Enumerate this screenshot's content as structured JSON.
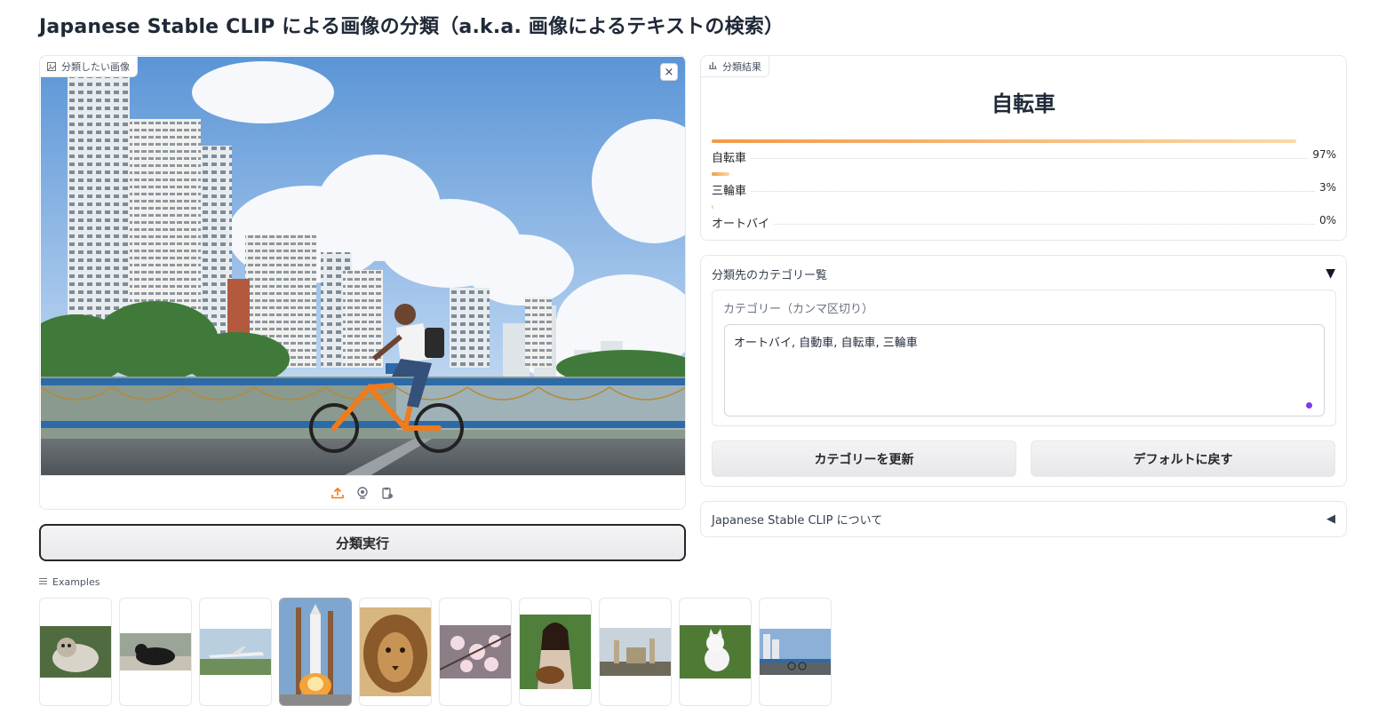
{
  "page": {
    "title": "Japanese Stable CLIP による画像の分類（a.k.a. 画像によるテキストの検索）"
  },
  "image_input": {
    "label": "分類したい画像",
    "close_symbol": "×"
  },
  "run_button": "分類実行",
  "result": {
    "label": "分類結果",
    "top_label": "自転車",
    "confidences": [
      {
        "label": "自転車",
        "percent_text": "97%",
        "value": 0.97
      },
      {
        "label": "三輪車",
        "percent_text": "3%",
        "value": 0.03
      },
      {
        "label": "オートバイ",
        "percent_text": "0%",
        "value": 0.0
      }
    ]
  },
  "categories": {
    "accordion_title": "分類先のカテゴリー覧",
    "accordion_arrow": "▼",
    "textbox_label": "カテゴリー（カンマ区切り）",
    "textbox_value": "オートバイ, 自動車, 自転車, 三輪車",
    "update_button": "カテゴリーを更新",
    "reset_button": "デフォルトに戻す"
  },
  "about": {
    "title": "Japanese Stable CLIP について",
    "arrow": "◀"
  },
  "examples": {
    "label": "Examples",
    "items": [
      "cat-photo",
      "black-cat-photo",
      "airplane-photo",
      "rocket-launch-photo",
      "lion-photo",
      "cherry-blossom-photo",
      "singer-photo",
      "palace-photo",
      "white-dog-photo",
      "cyclist-city-photo"
    ],
    "selected_index": 3
  },
  "colors": {
    "accent_orange": "#f29a4a",
    "textbox_dot": "#7c3aed"
  }
}
